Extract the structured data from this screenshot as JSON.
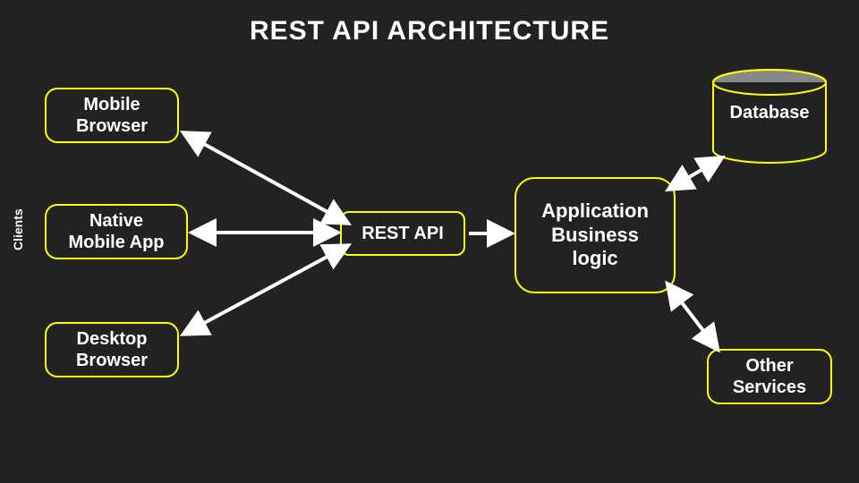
{
  "title": "REST API ARCHITECTURE",
  "clients_group_label": "Clients",
  "nodes": {
    "mobile_browser": "Mobile\nBrowser",
    "native_app": "Native\nMobile App",
    "desktop_browser": "Desktop\nBrowser",
    "rest_api": "REST API",
    "app_logic": "Application\nBusiness\nlogic",
    "database": "Database",
    "other_services": "Other\nServices"
  },
  "colors": {
    "bg": "#222222",
    "stroke": "#ffff00",
    "arrow": "#ffffff",
    "text": "#ffffff"
  },
  "edges": [
    {
      "from": "mobile_browser",
      "to": "rest_api",
      "bidirectional": true
    },
    {
      "from": "native_app",
      "to": "rest_api",
      "bidirectional": true
    },
    {
      "from": "desktop_browser",
      "to": "rest_api",
      "bidirectional": true
    },
    {
      "from": "rest_api",
      "to": "app_logic",
      "bidirectional": false
    },
    {
      "from": "app_logic",
      "to": "database",
      "bidirectional": true
    },
    {
      "from": "app_logic",
      "to": "other_services",
      "bidirectional": true
    }
  ]
}
